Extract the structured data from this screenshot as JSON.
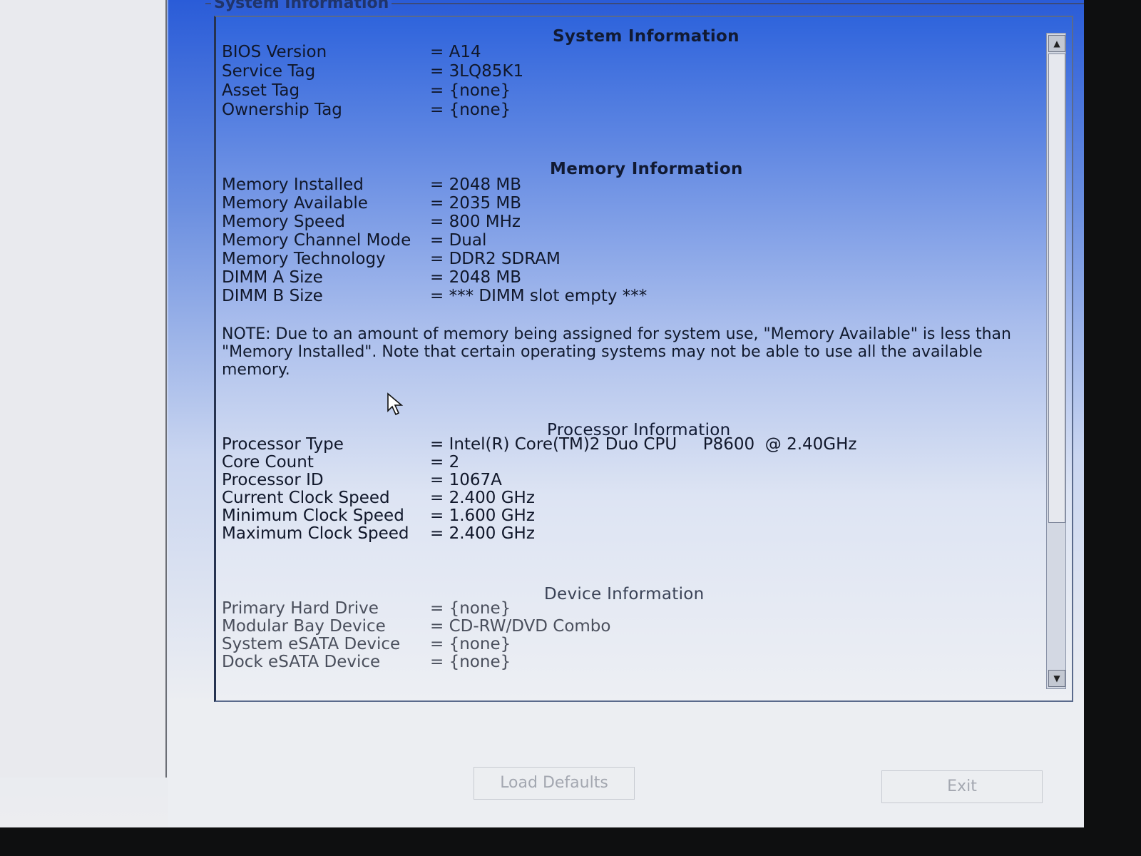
{
  "window": {
    "group_title": "System Information"
  },
  "system": {
    "heading": "System Information",
    "rows": [
      {
        "label": "BIOS Version",
        "value": "= A14"
      },
      {
        "label": "Service Tag",
        "value": "= 3LQ85K1"
      },
      {
        "label": "Asset Tag",
        "value": "= {none}"
      },
      {
        "label": "Ownership Tag",
        "value": "= {none}"
      }
    ]
  },
  "memory": {
    "heading": "Memory Information",
    "rows": [
      {
        "label": "Memory Installed",
        "value": "= 2048 MB"
      },
      {
        "label": "Memory Available",
        "value": "= 2035 MB"
      },
      {
        "label": "Memory Speed",
        "value": "= 800 MHz"
      },
      {
        "label": "Memory Channel Mode",
        "value": "= Dual"
      },
      {
        "label": "Memory Technology",
        "value": "= DDR2 SDRAM"
      },
      {
        "label": "DIMM A Size",
        "value": "= 2048 MB"
      },
      {
        "label": "DIMM B Size",
        "value": "= *** DIMM slot empty ***"
      }
    ],
    "note": "NOTE: Due to an amount of memory being assigned for system use, \"Memory Available\" is less than \"Memory Installed\". Note that certain operating systems may not be able to use all the available memory."
  },
  "processor": {
    "heading": "Processor Information",
    "rows": [
      {
        "label": "Processor Type",
        "value": "= Intel(R) Core(TM)2 Duo CPU     P8600  @ 2.40GHz"
      },
      {
        "label": "Core Count",
        "value": "= 2"
      },
      {
        "label": "Processor ID",
        "value": "= 1067A"
      },
      {
        "label": "Current Clock Speed",
        "value": "= 2.400 GHz"
      },
      {
        "label": "Minimum Clock Speed",
        "value": "= 1.600 GHz"
      },
      {
        "label": "Maximum Clock Speed",
        "value": "= 2.400 GHz"
      }
    ]
  },
  "device": {
    "heading": "Device Information",
    "rows": [
      {
        "label": "Primary Hard Drive",
        "value": "= {none}"
      },
      {
        "label": "Modular Bay Device",
        "value": "= CD-RW/DVD Combo"
      },
      {
        "label": "System eSATA Device",
        "value": "= {none}"
      },
      {
        "label": "Dock eSATA Device",
        "value": "= {none}"
      }
    ]
  },
  "buttons": {
    "load_defaults": "Load Defaults",
    "exit": "Exit"
  },
  "scrollbar": {
    "position_fraction": 0.0
  }
}
